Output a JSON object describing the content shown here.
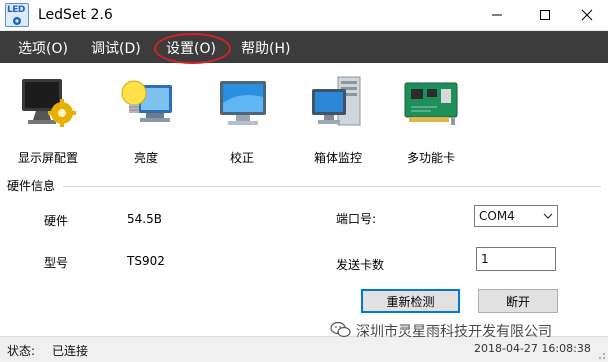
{
  "window": {
    "title": "LedSet 2.6",
    "app_icon": "led-app-icon",
    "app_icon_text": "LED",
    "controls": [
      "minimize-icon",
      "maximize-icon",
      "close-icon"
    ]
  },
  "menu": {
    "items": [
      {
        "label": "选项(O)"
      },
      {
        "label": "调试(D)"
      },
      {
        "label": "设置(O)"
      },
      {
        "label": "帮助(H)"
      }
    ],
    "highlighted_index": 2,
    "highlight_color": "#d0242a"
  },
  "toolbar": {
    "tools": [
      {
        "label": "显示屏配置",
        "icon": "monitor-gear-icon"
      },
      {
        "label": "亮度",
        "icon": "brightness-bulb-icon"
      },
      {
        "label": "校正",
        "icon": "calibration-monitor-icon"
      },
      {
        "label": "箱体监控",
        "icon": "cabinet-monitor-icon"
      },
      {
        "label": "多功能卡",
        "icon": "multifunction-card-icon"
      }
    ]
  },
  "hardware": {
    "group_title": "硬件信息",
    "firmware_label": "硬件",
    "firmware_value": "54.5B",
    "model_label": "型号",
    "model_value": "TS902",
    "port_label": "端口号:",
    "port_value": "COM4",
    "send_card_label": "发送卡数",
    "send_card_value": "1",
    "redetect_label": "重新检测",
    "disconnect_label": "断开"
  },
  "status": {
    "label": "状态:",
    "value": "已连接",
    "timestamp": "2018-04-27 16:08:38"
  },
  "watermark": {
    "text": "深圳市灵星雨科技开发有限公司",
    "icon": "wechat-icon"
  },
  "colors": {
    "menubar": "#3c3c3c",
    "accent": "#0078d7"
  }
}
